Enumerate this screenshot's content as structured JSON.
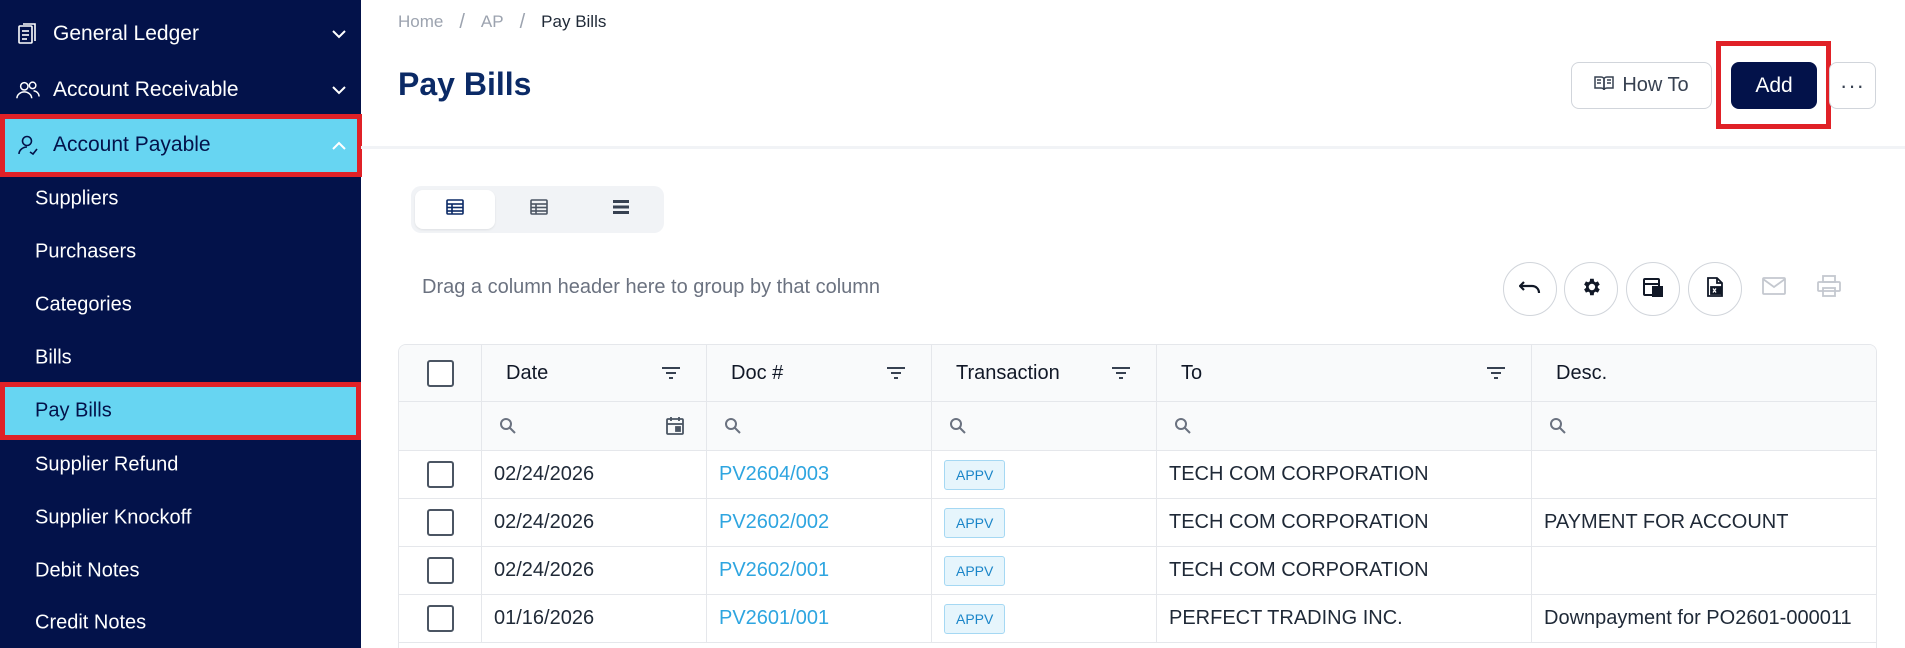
{
  "sidebar": {
    "top_items": [
      {
        "label": "General Ledger",
        "icon": "ledger-icon",
        "expanded": false
      },
      {
        "label": "Account Receivable",
        "icon": "users-icon",
        "expanded": false
      },
      {
        "label": "Account Payable",
        "icon": "user-icon",
        "expanded": true
      }
    ],
    "sub_items": [
      {
        "label": "Suppliers"
      },
      {
        "label": "Purchasers"
      },
      {
        "label": "Categories"
      },
      {
        "label": "Bills"
      },
      {
        "label": "Pay Bills",
        "active": true
      },
      {
        "label": "Supplier Refund"
      },
      {
        "label": "Supplier Knockoff"
      },
      {
        "label": "Debit Notes"
      },
      {
        "label": "Credit Notes"
      }
    ],
    "active_color": "#67d5f2",
    "background": "#03124a"
  },
  "breadcrumb": {
    "home": "Home",
    "section": "AP",
    "current": "Pay Bills",
    "separator": "/"
  },
  "header": {
    "title": "Pay Bills",
    "howto_label": "How To",
    "add_label": "Add",
    "more_label": "···"
  },
  "toolbar": {
    "group_hint": "Drag a column header here to group by that column",
    "view_modes": [
      "grid-view-icon",
      "table-view-icon",
      "list-view-icon"
    ],
    "tools": [
      "undo-icon",
      "settings-icon",
      "column-chooser-icon",
      "export-excel-icon",
      "email-icon",
      "print-icon"
    ]
  },
  "table": {
    "columns": [
      "Date",
      "Doc #",
      "Transaction",
      "To",
      "Desc."
    ],
    "rows": [
      {
        "date": "02/24/2026",
        "doc": "PV2604/003",
        "status": "APPV",
        "to": "TECH COM CORPORATION",
        "desc": ""
      },
      {
        "date": "02/24/2026",
        "doc": "PV2602/002",
        "status": "APPV",
        "to": "TECH COM CORPORATION",
        "desc": "PAYMENT FOR ACCOUNT"
      },
      {
        "date": "02/24/2026",
        "doc": "PV2602/001",
        "status": "APPV",
        "to": "TECH COM CORPORATION",
        "desc": ""
      },
      {
        "date": "01/16/2026",
        "doc": "PV2601/001",
        "status": "APPV",
        "to": "PERFECT TRADING INC.",
        "desc": "Downpayment for PO2601-000011"
      }
    ]
  },
  "colors": {
    "brand_dark": "#03124a",
    "title": "#0b2a66",
    "link": "#2ea5e0",
    "highlight": "#e02127"
  }
}
